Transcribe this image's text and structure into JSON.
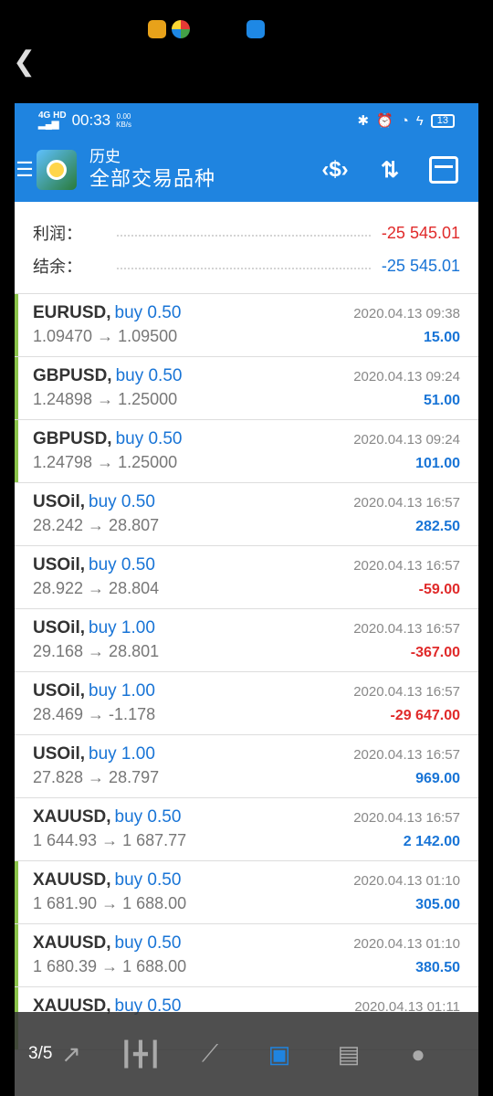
{
  "viewer": {
    "back_icon": "back-chevron-icon",
    "counter": "3/5"
  },
  "status_bar": {
    "net": "4G+HD 4G HD",
    "time": "00:33",
    "speed": "0.00\nKB/s",
    "battery": "13"
  },
  "app_bar": {
    "subtitle": "历史",
    "title": "全部交易品种"
  },
  "summary": {
    "profit_label": "利润：",
    "profit_value": "-25 545.01",
    "balance_label": "结余：",
    "balance_value": "-25 545.01"
  },
  "trades": [
    {
      "symbol": "EURUSD,",
      "side": "buy 0.50",
      "date": "2020.04.13 09:38",
      "prices": "1.09470 → 1.09500",
      "profit": "15.00",
      "marked": true,
      "positive": true
    },
    {
      "symbol": "GBPUSD,",
      "side": "buy 0.50",
      "date": "2020.04.13 09:24",
      "prices": "1.24898 → 1.25000",
      "profit": "51.00",
      "marked": true,
      "positive": true
    },
    {
      "symbol": "GBPUSD,",
      "side": "buy 0.50",
      "date": "2020.04.13 09:24",
      "prices": "1.24798 → 1.25000",
      "profit": "101.00",
      "marked": true,
      "positive": true
    },
    {
      "symbol": "USOil,",
      "side": "buy 0.50",
      "date": "2020.04.13 16:57",
      "prices": "28.242 → 28.807",
      "profit": "282.50",
      "marked": false,
      "positive": true
    },
    {
      "symbol": "USOil,",
      "side": "buy 0.50",
      "date": "2020.04.13 16:57",
      "prices": "28.922 → 28.804",
      "profit": "-59.00",
      "marked": false,
      "positive": false
    },
    {
      "symbol": "USOil,",
      "side": "buy 1.00",
      "date": "2020.04.13 16:57",
      "prices": "29.168 → 28.801",
      "profit": "-367.00",
      "marked": false,
      "positive": false
    },
    {
      "symbol": "USOil,",
      "side": "buy 1.00",
      "date": "2020.04.13 16:57",
      "prices": "28.469 → -1.178",
      "profit": "-29 647.00",
      "marked": false,
      "positive": false
    },
    {
      "symbol": "USOil,",
      "side": "buy 1.00",
      "date": "2020.04.13 16:57",
      "prices": "27.828 → 28.797",
      "profit": "969.00",
      "marked": false,
      "positive": true
    },
    {
      "symbol": "XAUUSD,",
      "side": "buy 0.50",
      "date": "2020.04.13 16:57",
      "prices": "1 644.93 → 1 687.77",
      "profit": "2 142.00",
      "marked": false,
      "positive": true
    },
    {
      "symbol": "XAUUSD,",
      "side": "buy 0.50",
      "date": "2020.04.13 01:10",
      "prices": "1 681.90 → 1 688.00",
      "profit": "305.00",
      "marked": true,
      "positive": true
    },
    {
      "symbol": "XAUUSD,",
      "side": "buy 0.50",
      "date": "2020.04.13 01:10",
      "prices": "1 680.39 → 1 688.00",
      "profit": "380.50",
      "marked": true,
      "positive": true
    },
    {
      "symbol": "XAUUSD,",
      "side": "buy 0.50",
      "date": "2020.04.13 01:11",
      "prices": "",
      "profit": "",
      "marked": true,
      "positive": true
    }
  ],
  "bottom_nav": [
    {
      "icon": "quotes-arrow-icon",
      "active": false
    },
    {
      "icon": "candlestick-chart-icon",
      "active": false
    },
    {
      "icon": "trend-chart-icon",
      "active": false
    },
    {
      "icon": "history-inbox-icon",
      "active": true
    },
    {
      "icon": "news-icon",
      "active": false
    },
    {
      "icon": "chat-icon",
      "active": false
    }
  ]
}
